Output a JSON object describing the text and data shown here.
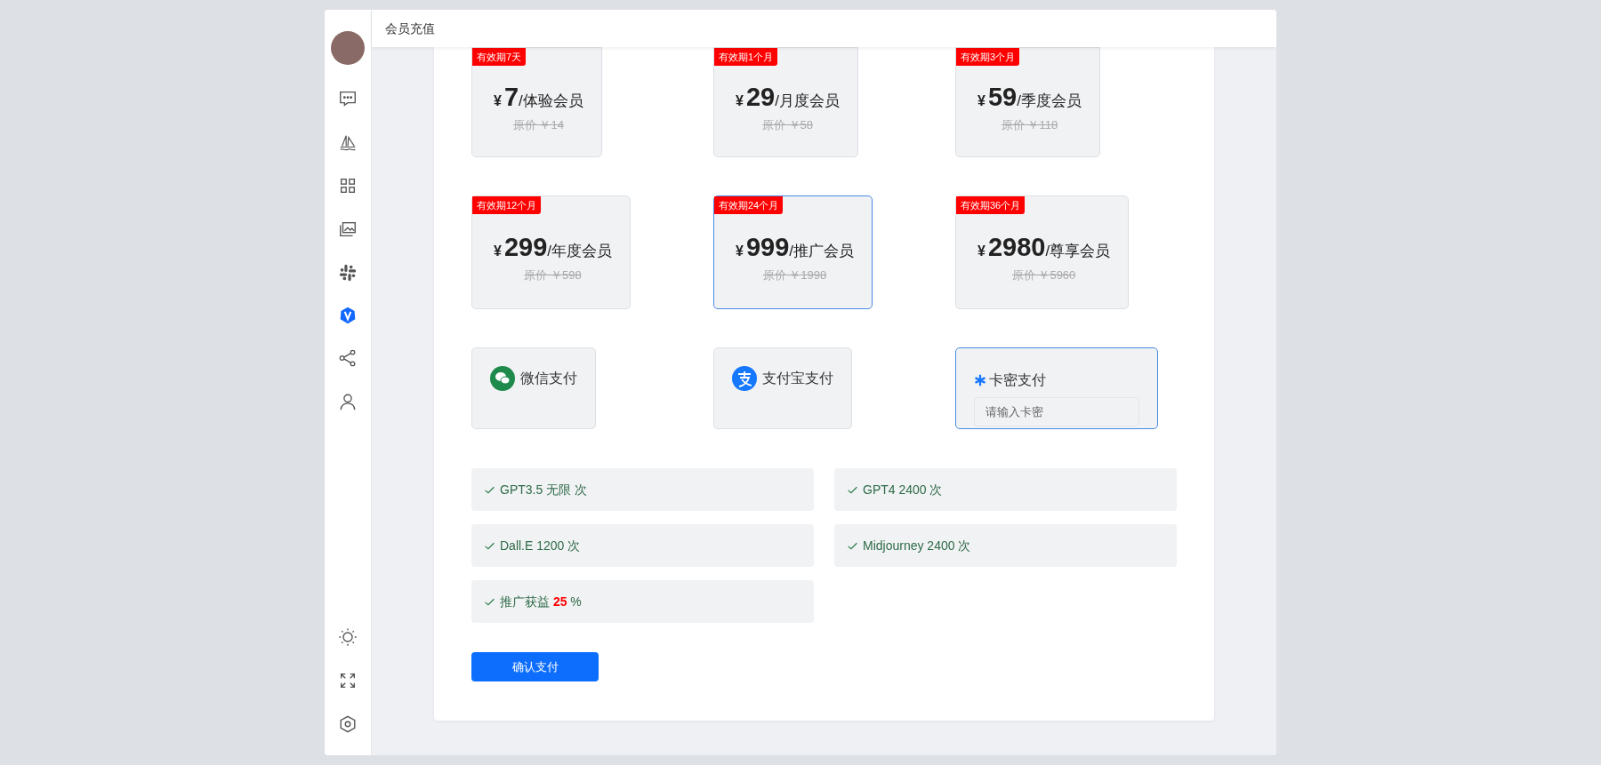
{
  "header": {
    "title": "会员充值"
  },
  "plans": [
    {
      "badge": "有效期7天",
      "currency": "¥",
      "price": "7",
      "name": "/体验会员",
      "original": "原价 ￥14",
      "selected": false
    },
    {
      "badge": "有效期1个月",
      "currency": "¥",
      "price": "29",
      "name": "/月度会员",
      "original": "原价 ￥58",
      "selected": false
    },
    {
      "badge": "有效期3个月",
      "currency": "¥",
      "price": "59",
      "name": "/季度会员",
      "original": "原价 ￥118",
      "selected": false
    },
    {
      "badge": "有效期12个月",
      "currency": "¥",
      "price": "299",
      "name": "/年度会员",
      "original": "原价 ￥598",
      "selected": false
    },
    {
      "badge": "有效期24个月",
      "currency": "¥",
      "price": "999",
      "name": "/推广会员",
      "original": "原价 ￥1998",
      "selected": true
    },
    {
      "badge": "有效期36个月",
      "currency": "¥",
      "price": "2980",
      "name": "/尊享会员",
      "original": "原价 ￥5960",
      "selected": false
    }
  ],
  "payments": [
    {
      "kind": "wechat",
      "label": "微信支付",
      "selected": false
    },
    {
      "kind": "alipay",
      "label": "支付宝支付",
      "selected": false
    },
    {
      "kind": "card",
      "label": "卡密支付",
      "selected": true,
      "placeholder": "请输入卡密"
    }
  ],
  "features": [
    {
      "text": "GPT3.5 无限 次"
    },
    {
      "text": "GPT4 2400 次"
    },
    {
      "text": "Dall.E 1200 次"
    },
    {
      "text": "Midjourney 2400 次"
    },
    {
      "text": "推广获益 **25** %"
    }
  ],
  "confirm_button": "确认支付"
}
